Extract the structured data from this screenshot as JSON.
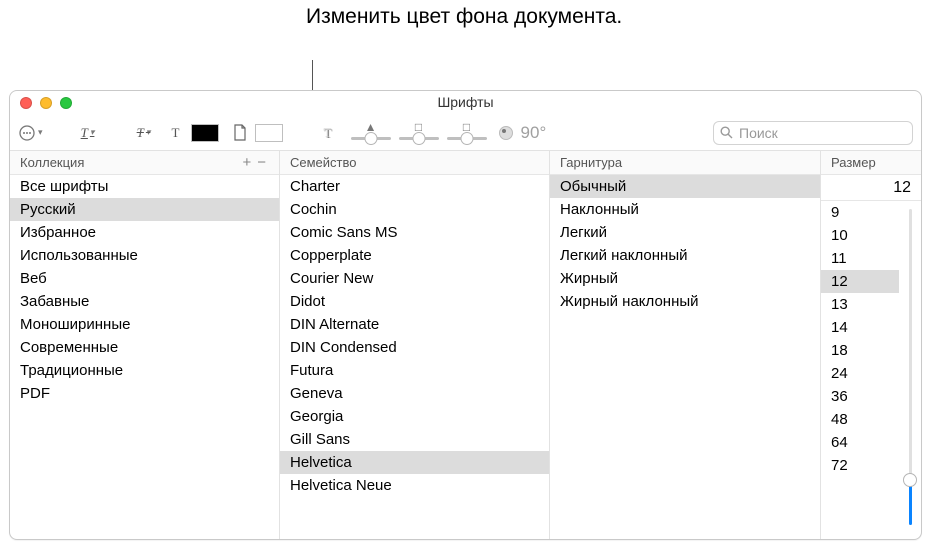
{
  "callout": "Изменить цвет фона документа.",
  "window": {
    "title": "Шрифты",
    "toolbar": {
      "angle_label": "90°"
    },
    "search": {
      "placeholder": "Поиск"
    }
  },
  "columns": {
    "collection": {
      "header": "Коллекция",
      "items": [
        "Все шрифты",
        "Русский",
        "Избранное",
        "Использованные",
        "Веб",
        "Забавные",
        "Моноширинные",
        "Современные",
        "Традиционные",
        "PDF"
      ],
      "selected_index": 1
    },
    "family": {
      "header": "Семейство",
      "items": [
        "Charter",
        "Cochin",
        "Comic Sans MS",
        "Copperplate",
        "Courier New",
        "Didot",
        "DIN Alternate",
        "DIN Condensed",
        "Futura",
        "Geneva",
        "Georgia",
        "Gill Sans",
        "Helvetica",
        "Helvetica Neue"
      ],
      "selected_index": 12
    },
    "typeface": {
      "header": "Гарнитура",
      "items": [
        "Обычный",
        "Наклонный",
        "Легкий",
        "Легкий наклонный",
        "Жирный",
        "Жирный наклонный"
      ],
      "selected_index": 0
    },
    "size": {
      "header": "Размер",
      "current": "12",
      "items": [
        "9",
        "10",
        "11",
        "12",
        "13",
        "14",
        "18",
        "24",
        "36",
        "48",
        "64",
        "72"
      ],
      "selected_index": 3
    }
  }
}
